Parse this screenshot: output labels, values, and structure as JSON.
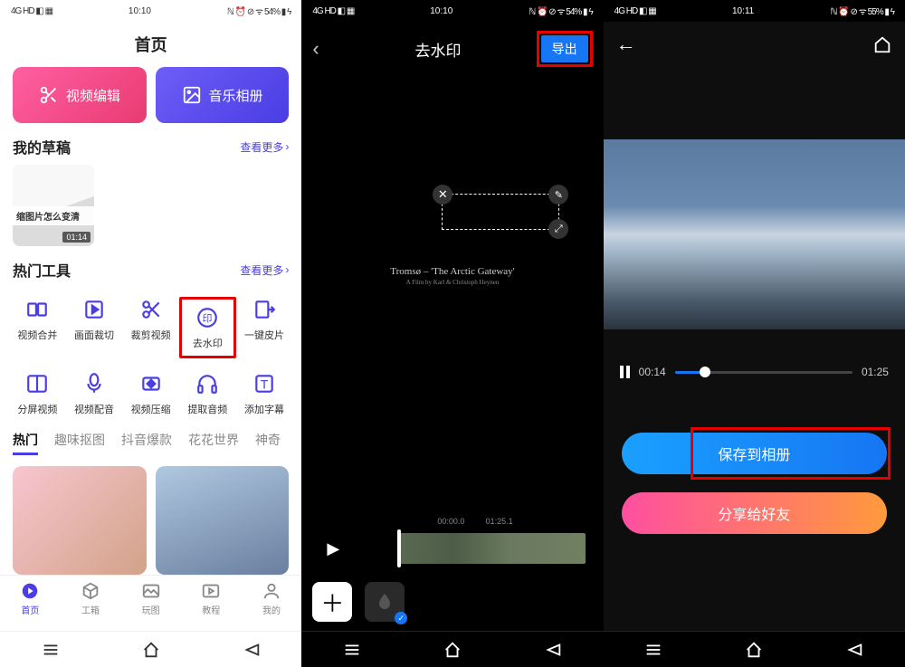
{
  "status": {
    "left_icons": "4G HD ◧ ▦",
    "time1": "10:10",
    "time2": "10:10",
    "time3": "10:11",
    "right1": "ℕ ⏰ ⊘ ᯤ 54% ▮ ϟ",
    "right2": "ℕ ⏰ ⊘ ᯤ 54% ▮ ϟ",
    "right3": "ℕ ⏰ ⊘ ᯤ 55% ▮ ϟ"
  },
  "screen1": {
    "title": "首页",
    "card1": "视频编辑",
    "card2": "音乐相册",
    "drafts_title": "我的草稿",
    "view_more": "查看更多",
    "draft_caption": "缩图片怎么变清",
    "draft_time": "01:14",
    "tools_title": "热门工具",
    "tools": [
      "视频合并",
      "画面裁切",
      "裁剪视频",
      "去水印",
      "一键皮片",
      "分屏视频",
      "视频配音",
      "视频压缩",
      "提取音频",
      "添加字幕"
    ],
    "tabs": [
      "热门",
      "趣味抠图",
      "抖音爆款",
      "花花世界",
      "神奇"
    ],
    "bottom_tabs": [
      "首页",
      "工箱",
      "玩图",
      "教程",
      "我的"
    ]
  },
  "screen2": {
    "title": "去水印",
    "export": "导出",
    "video_title": "Tromsø – 'The Arctic Gateway'",
    "video_subtitle": "A Film by Karl & Christoph Heynen",
    "time_start": "00:00.0",
    "time_end": "01:25.1"
  },
  "screen3": {
    "cur_time": "00:14",
    "total_time": "01:25",
    "save_btn": "保存到相册",
    "share_btn": "分享给好友"
  }
}
